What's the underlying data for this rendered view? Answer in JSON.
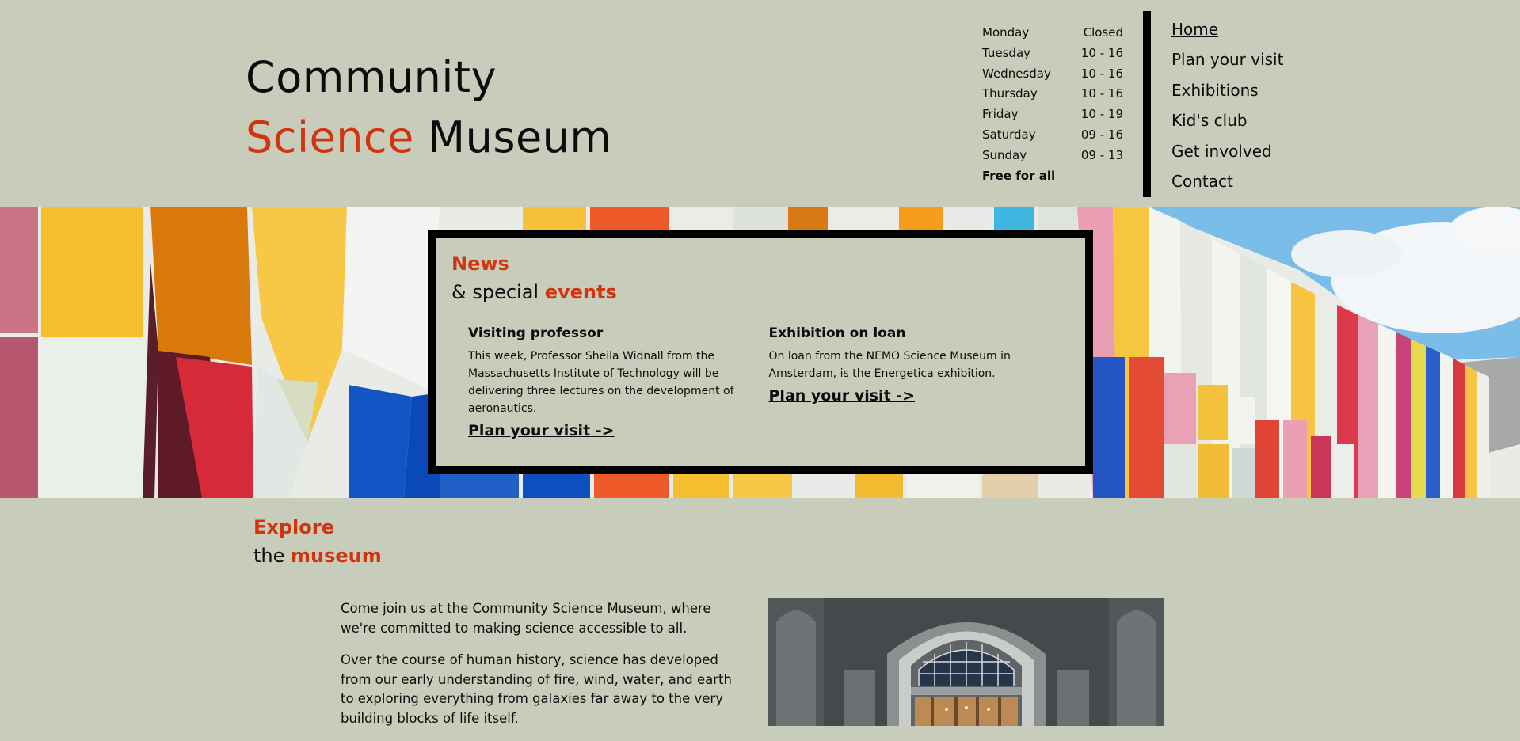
{
  "brand": {
    "line1": "Community",
    "line2_accent": "Science",
    "line2_rest": " Museum"
  },
  "hours": {
    "rows": [
      {
        "day": "Monday",
        "time": "Closed"
      },
      {
        "day": "Tuesday",
        "time": "10 - 16"
      },
      {
        "day": "Wednesday",
        "time": "10 - 16"
      },
      {
        "day": "Thursday",
        "time": "10 - 16"
      },
      {
        "day": "Friday",
        "time": "10 - 19"
      },
      {
        "day": "Saturday",
        "time": "09 - 16"
      },
      {
        "day": "Sunday",
        "time": "09 - 13"
      }
    ],
    "note": "Free for all"
  },
  "nav": {
    "items": [
      {
        "label": "Home",
        "active": true
      },
      {
        "label": "Plan your visit"
      },
      {
        "label": "Exhibitions"
      },
      {
        "label": "Kid's club"
      },
      {
        "label": "Get involved"
      },
      {
        "label": "Contact"
      }
    ]
  },
  "news": {
    "heading_accent": "News",
    "heading_line2_pre": "& special ",
    "heading_line2_accent": "events",
    "items": [
      {
        "title": "Visiting professor",
        "body": "This week, Professor Sheila Widnall from the Massachusetts Institute of Technology will be delivering three lectures on the development of aeronautics.",
        "link": "Plan your visit ->"
      },
      {
        "title": "Exhibition on loan",
        "body": "On loan from the NEMO Science Museum in Amsterdam, is the Energetica exhibition.",
        "link": "Plan your visit ->"
      }
    ]
  },
  "explore": {
    "heading_accent": "Explore",
    "heading_line2_pre": "the ",
    "heading_line2_accent": "museum",
    "paragraphs": [
      "Come join us at the Community Science Museum, where we're committed to making science accessible to all.",
      "Over the course of human history, science has developed from our early understanding of fire, wind, water, and earth to exploring everything from galaxies far away to the very building blocks of life itself."
    ]
  },
  "colors": {
    "background": "#c8cdbb",
    "accent": "#d2340f",
    "text": "#0c0c0c"
  }
}
